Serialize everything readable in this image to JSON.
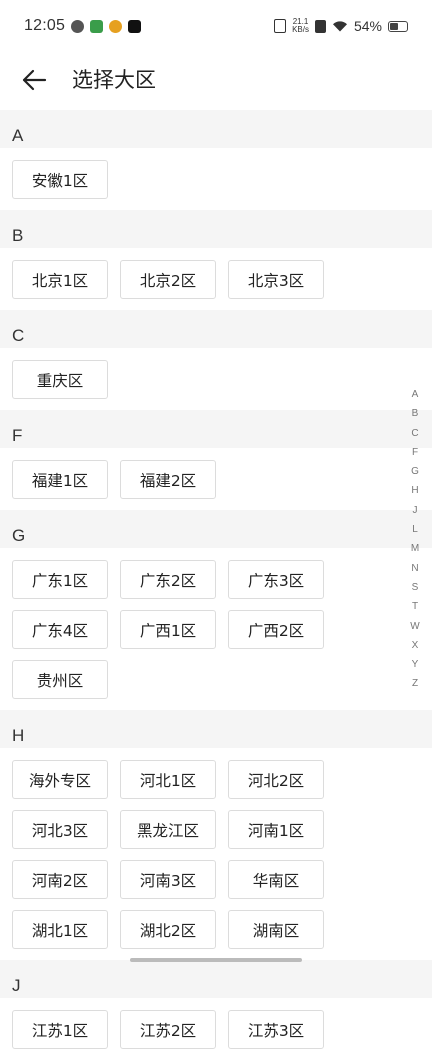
{
  "status_bar": {
    "time": "12:05",
    "net_speed_value": "21.1",
    "net_speed_unit": "KB/s",
    "battery": "54%",
    "battery_level": 0.54,
    "icons": [
      "check-circle-icon",
      "app-icon",
      "weibo-icon",
      "tiktok-icon",
      "vibrate-icon",
      "no-sim-icon",
      "wifi-icon",
      "battery-icon"
    ]
  },
  "header": {
    "title": "选择大区",
    "back_icon": "arrow-left-icon"
  },
  "sections": [
    {
      "letter": "A",
      "items": [
        "安徽1区"
      ]
    },
    {
      "letter": "B",
      "items": [
        "北京1区",
        "北京2区",
        "北京3区"
      ]
    },
    {
      "letter": "C",
      "items": [
        "重庆区"
      ]
    },
    {
      "letter": "F",
      "items": [
        "福建1区",
        "福建2区"
      ]
    },
    {
      "letter": "G",
      "items": [
        "广东1区",
        "广东2区",
        "广东3区",
        "广东4区",
        "广西1区",
        "广西2区",
        "贵州区"
      ]
    },
    {
      "letter": "H",
      "items": [
        "海外专区",
        "河北1区",
        "河北2区",
        "河北3区",
        "黑龙江区",
        "河南1区",
        "河南2区",
        "河南3区",
        "华南区",
        "湖北1区",
        "湖北2区",
        "湖南区"
      ]
    },
    {
      "letter": "J",
      "items": [
        "江苏1区",
        "江苏2区",
        "江苏3区"
      ]
    }
  ],
  "index_letters": [
    "A",
    "B",
    "C",
    "F",
    "G",
    "H",
    "J",
    "L",
    "M",
    "N",
    "S",
    "T",
    "W",
    "X",
    "Y",
    "Z"
  ]
}
